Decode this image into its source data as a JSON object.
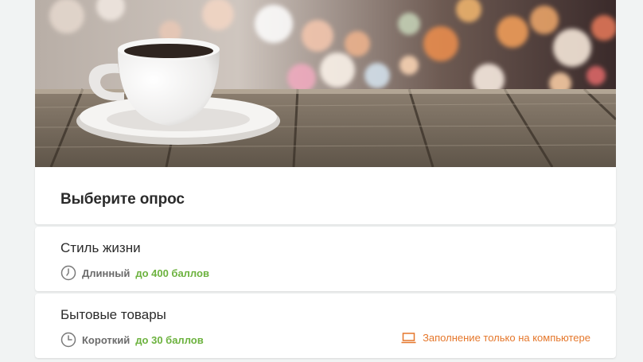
{
  "header": {
    "title": "Выберите опрос"
  },
  "surveys": [
    {
      "title": "Стиль жизни",
      "duration": "Длинный",
      "points": "до 400 баллов",
      "note": ""
    },
    {
      "title": "Бытовые товары",
      "duration": "Короткий",
      "points": "до 30 баллов",
      "note": "Заполнение только на компьютере"
    }
  ],
  "icons": {
    "duration": "clock-icon",
    "desktop_only": "laptop-icon"
  },
  "colors": {
    "points": "#6cb23e",
    "desktop_note": "#e5772b",
    "background": "#f1f3f3"
  }
}
